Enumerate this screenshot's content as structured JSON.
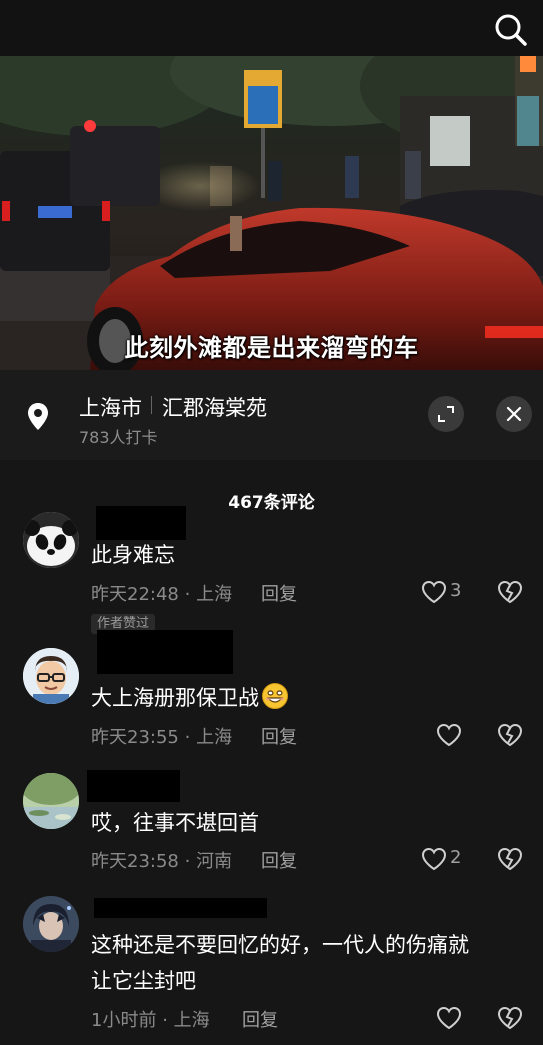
{
  "icons": {
    "search": "search-icon",
    "pin": "location-pin-icon",
    "expand": "expand-icon",
    "close": "close-icon",
    "like": "heart-icon",
    "dislike": "broken-heart-icon",
    "emoji": "grinning-face-emoji"
  },
  "video": {
    "subtitle": "此刻外滩都是出来溜弯的车"
  },
  "location": {
    "city": "上海市",
    "place": "汇郡海棠苑",
    "checkins": "783人打卡"
  },
  "comments_header": "467条评论",
  "comments": [
    {
      "text": "此身难忘",
      "time": "昨天22:48",
      "region": "上海",
      "reply_label": "回复",
      "likes": "3"
    },
    {
      "badge": "作者赞过",
      "text": "大上海册那保卫战",
      "time": "昨天23:55",
      "region": "上海",
      "reply_label": "回复",
      "likes": ""
    },
    {
      "text": "哎，往事不堪回首",
      "time": "昨天23:58",
      "region": "河南",
      "reply_label": "回复",
      "likes": "2"
    },
    {
      "text_line1": "这种还是不要回忆的好，一代人的伤痛就",
      "text_line2": "让它尘封吧",
      "time": "1小时前",
      "region": "上海",
      "reply_label": "回复",
      "likes": ""
    }
  ],
  "meta_separator": "·",
  "colors": {
    "background": "#161616",
    "location_bar": "#1b1b1b",
    "secondary_text": "#8a8a8a",
    "redaction": "#000000"
  }
}
